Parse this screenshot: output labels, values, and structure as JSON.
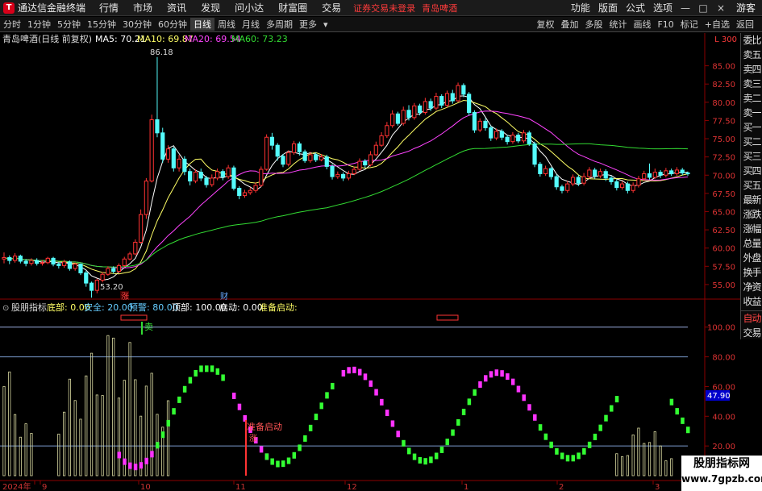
{
  "window": {
    "app_title": "通达信金融终端",
    "notice": "证券交易未登录",
    "stock_title": "青岛啤酒",
    "guest": "游客"
  },
  "menu": {
    "left": [
      "行情",
      "市场",
      "资讯",
      "发现",
      "问小达",
      "财富圈",
      "交易"
    ],
    "right": [
      "功能",
      "版面",
      "公式",
      "选项"
    ]
  },
  "window_controls": [
    "—",
    "□",
    "×"
  ],
  "toolbar": {
    "periods": [
      "分时",
      "1分钟",
      "5分钟",
      "15分钟",
      "30分钟",
      "60分钟",
      "日线",
      "周线",
      "月线",
      "多周期",
      "更多"
    ],
    "active_period": "日线",
    "tools": [
      "复权",
      "叠加",
      "多股",
      "统计",
      "画线",
      "F10",
      "标记",
      "+自选",
      "返回"
    ]
  },
  "main_chart": {
    "stock_label": "青岛啤酒(日线 前复权)",
    "ma_legend": [
      {
        "label": "MA5: 70.21",
        "color": "#ffffff"
      },
      {
        "label": "MA10: 69.87",
        "color": "#ffff66"
      },
      {
        "label": "MA20: 69.54",
        "color": "#ff44ff"
      },
      {
        "label": "MA60: 73.23",
        "color": "#33dd33"
      }
    ],
    "y_axis": {
      "ticks": [
        55.0,
        57.5,
        60.0,
        62.5,
        65.0,
        67.5,
        70.0,
        72.5,
        75.0,
        77.5,
        80.0,
        82.5,
        85.0
      ],
      "range": [
        53.0,
        87.5
      ]
    },
    "annotations": {
      "high": "86.18",
      "low": "53.20",
      "mark_zhang": "涨",
      "mark_cai": "财",
      "corner": "L 300"
    },
    "candles": [
      [
        58.5,
        58.7,
        59.4,
        57.9
      ],
      [
        58.7,
        58.3,
        59.0,
        57.8
      ],
      [
        58.3,
        58.9,
        59.3,
        58.0
      ],
      [
        58.9,
        58.2,
        59.1,
        57.9
      ],
      [
        58.2,
        57.9,
        58.5,
        57.5
      ],
      [
        57.9,
        58.3,
        58.6,
        57.6
      ],
      [
        58.3,
        57.9,
        58.6,
        57.6
      ],
      [
        57.9,
        58.0,
        58.3,
        57.6
      ],
      [
        58.0,
        58.6,
        58.8,
        57.8
      ],
      [
        58.6,
        57.8,
        58.8,
        57.5
      ],
      [
        57.8,
        57.6,
        58.1,
        57.2
      ],
      [
        57.6,
        58.1,
        58.4,
        57.3
      ],
      [
        58.1,
        57.2,
        58.3,
        56.9
      ],
      [
        57.2,
        57.8,
        58.0,
        56.9
      ],
      [
        57.8,
        56.6,
        57.9,
        56.3
      ],
      [
        56.6,
        55.2,
        56.9,
        54.7
      ],
      [
        55.2,
        54.2,
        55.4,
        53.2
      ],
      [
        54.2,
        55.6,
        55.8,
        53.8
      ],
      [
        55.6,
        56.4,
        56.7,
        55.3
      ],
      [
        56.4,
        57.2,
        57.5,
        56.2
      ],
      [
        57.2,
        56.8,
        57.5,
        56.5
      ],
      [
        56.8,
        57.6,
        57.9,
        56.6
      ],
      [
        57.6,
        58.5,
        58.8,
        57.4
      ],
      [
        58.5,
        59.2,
        59.5,
        58.3
      ],
      [
        59.2,
        60.8,
        61.2,
        59.0
      ],
      [
        60.8,
        64.6,
        65.3,
        60.6
      ],
      [
        64.6,
        69.2,
        69.6,
        64.0
      ],
      [
        69.2,
        77.6,
        78.3,
        69.0
      ],
      [
        77.6,
        75.8,
        86.2,
        75.2
      ],
      [
        75.8,
        72.2,
        76.5,
        71.7
      ],
      [
        72.2,
        73.6,
        74.1,
        71.7
      ],
      [
        73.6,
        71.0,
        73.9,
        70.5
      ],
      [
        71.0,
        72.2,
        72.8,
        70.5
      ],
      [
        72.2,
        70.5,
        72.6,
        70.0
      ],
      [
        70.5,
        69.2,
        70.9,
        68.6
      ],
      [
        69.2,
        70.4,
        70.8,
        68.9
      ],
      [
        70.4,
        69.6,
        70.9,
        69.2
      ],
      [
        69.6,
        68.7,
        69.9,
        68.3
      ],
      [
        68.7,
        69.6,
        70.1,
        68.4
      ],
      [
        69.6,
        70.5,
        70.9,
        69.3
      ],
      [
        70.5,
        69.8,
        70.8,
        69.3
      ],
      [
        69.8,
        71.0,
        71.4,
        69.5
      ],
      [
        71.0,
        68.2,
        71.3,
        67.9
      ],
      [
        68.2,
        67.2,
        68.5,
        66.7
      ],
      [
        67.2,
        67.6,
        68.0,
        66.9
      ],
      [
        67.6,
        67.9,
        68.3,
        67.3
      ],
      [
        67.9,
        68.6,
        69.0,
        67.6
      ],
      [
        68.6,
        70.8,
        71.2,
        68.4
      ],
      [
        70.8,
        75.2,
        75.6,
        70.6
      ],
      [
        75.2,
        74.1,
        75.8,
        73.5
      ],
      [
        74.1,
        72.6,
        74.4,
        72.0
      ],
      [
        72.6,
        71.5,
        72.9,
        71.1
      ],
      [
        71.5,
        73.1,
        73.4,
        71.2
      ],
      [
        73.1,
        74.3,
        74.7,
        72.8
      ],
      [
        74.3,
        73.2,
        74.6,
        72.7
      ],
      [
        73.2,
        72.0,
        73.5,
        71.7
      ],
      [
        72.0,
        72.8,
        73.2,
        71.7
      ],
      [
        72.8,
        72.1,
        73.1,
        71.8
      ],
      [
        72.1,
        72.5,
        72.9,
        71.9
      ],
      [
        72.5,
        71.2,
        72.8,
        70.8
      ],
      [
        71.2,
        69.8,
        71.5,
        69.4
      ],
      [
        69.8,
        70.1,
        70.5,
        69.5
      ],
      [
        70.1,
        69.6,
        70.4,
        69.2
      ],
      [
        69.6,
        70.2,
        70.6,
        69.3
      ],
      [
        70.2,
        70.8,
        71.2,
        70.0
      ],
      [
        70.8,
        71.9,
        72.3,
        70.6
      ],
      [
        71.9,
        71.4,
        72.2,
        71.0
      ],
      [
        71.4,
        72.8,
        73.3,
        71.2
      ],
      [
        72.8,
        74.1,
        74.6,
        72.6
      ],
      [
        74.1,
        75.4,
        75.9,
        73.9
      ],
      [
        75.4,
        76.8,
        77.3,
        75.1
      ],
      [
        76.8,
        78.4,
        78.9,
        76.5
      ],
      [
        78.4,
        77.1,
        78.7,
        76.8
      ],
      [
        77.1,
        78.9,
        79.4,
        76.8
      ],
      [
        78.9,
        77.9,
        79.6,
        77.5
      ],
      [
        77.9,
        79.5,
        79.9,
        77.6
      ],
      [
        79.5,
        78.6,
        79.8,
        78.2
      ],
      [
        78.6,
        80.1,
        80.6,
        78.3
      ],
      [
        80.1,
        79.2,
        80.5,
        78.8
      ],
      [
        79.2,
        80.8,
        81.3,
        78.9
      ],
      [
        80.8,
        79.6,
        81.1,
        79.2
      ],
      [
        79.6,
        81.2,
        81.6,
        79.3
      ],
      [
        81.2,
        80.2,
        81.7,
        79.8
      ],
      [
        80.2,
        82.3,
        82.7,
        80.0
      ],
      [
        82.3,
        81.1,
        82.6,
        80.7
      ],
      [
        81.1,
        78.6,
        81.4,
        78.2
      ],
      [
        78.6,
        76.2,
        78.9,
        75.8
      ],
      [
        76.2,
        77.4,
        77.8,
        75.9
      ],
      [
        77.4,
        76.5,
        77.8,
        76.1
      ],
      [
        76.5,
        75.1,
        76.8,
        74.7
      ],
      [
        75.1,
        76.0,
        76.4,
        74.8
      ],
      [
        76.0,
        75.2,
        76.3,
        74.8
      ],
      [
        75.2,
        74.6,
        75.5,
        74.2
      ],
      [
        74.6,
        75.5,
        75.9,
        74.3
      ],
      [
        75.5,
        74.7,
        75.8,
        74.4
      ],
      [
        74.7,
        75.8,
        76.2,
        74.4
      ],
      [
        75.8,
        74.3,
        76.1,
        74.0
      ],
      [
        74.3,
        71.5,
        74.6,
        71.1
      ],
      [
        71.5,
        70.2,
        71.8,
        69.8
      ],
      [
        70.2,
        70.9,
        71.3,
        69.9
      ],
      [
        70.9,
        69.8,
        71.1,
        69.4
      ],
      [
        69.8,
        68.4,
        70.1,
        68.0
      ],
      [
        68.4,
        67.9,
        68.7,
        67.5
      ],
      [
        67.9,
        68.8,
        69.2,
        67.6
      ],
      [
        68.8,
        69.7,
        70.1,
        68.5
      ],
      [
        69.7,
        68.9,
        70.0,
        68.5
      ],
      [
        68.9,
        69.8,
        70.3,
        68.6
      ],
      [
        69.8,
        70.7,
        71.1,
        69.5
      ],
      [
        70.7,
        69.9,
        71.0,
        69.5
      ],
      [
        69.9,
        70.5,
        70.9,
        69.6
      ],
      [
        70.5,
        69.6,
        70.8,
        69.2
      ],
      [
        69.6,
        69.1,
        69.9,
        68.7
      ],
      [
        69.1,
        68.3,
        69.4,
        67.9
      ],
      [
        68.3,
        68.8,
        69.2,
        68.0
      ],
      [
        68.8,
        67.9,
        69.1,
        67.5
      ],
      [
        67.9,
        68.6,
        69.0,
        67.6
      ],
      [
        68.6,
        69.5,
        69.9,
        68.3
      ],
      [
        69.5,
        70.2,
        70.6,
        69.2
      ],
      [
        70.2,
        69.7,
        71.6,
        69.4
      ],
      [
        69.7,
        70.4,
        70.9,
        69.5
      ],
      [
        70.4,
        70.0,
        70.7,
        69.6
      ],
      [
        70.0,
        70.6,
        71.0,
        69.7
      ],
      [
        70.6,
        70.2,
        70.9,
        69.9
      ],
      [
        70.2,
        70.7,
        71.1,
        69.9
      ],
      [
        70.7,
        70.3,
        71.0,
        70.0
      ],
      [
        70.3,
        70.2,
        70.5,
        69.9
      ]
    ]
  },
  "sub_chart": {
    "legend": [
      {
        "label": "股朋指标",
        "color": "#dddddd"
      },
      {
        "label": "底部: 0.00",
        "color": "#ffff66"
      },
      {
        "label": "安全: 20.00",
        "color": "#66ccff"
      },
      {
        "label": "预警: 80.00",
        "color": "#66ccff"
      },
      {
        "label": "顶部: 100.00",
        "color": "#ffffff"
      },
      {
        "label": "启动: 0.00",
        "color": "#ffffff"
      },
      {
        "label": "准备启动:",
        "color": "#ffff66"
      }
    ],
    "y_axis": {
      "ticks": [
        "20.00",
        "40.00",
        "60.00",
        "80.00",
        "100.00"
      ],
      "range": [
        0,
        108
      ]
    },
    "current_value": "47.90",
    "text_marks": {
      "sell": "卖",
      "prepare": "准备启动",
      "up": "涨"
    },
    "x_labels": [
      "2024年",
      "9",
      "10",
      "11",
      "12",
      "1",
      "2",
      "3"
    ],
    "magenta_segments": [
      [
        21,
        28
      ],
      [
        42,
        48
      ],
      [
        62,
        72
      ],
      [
        87,
        97
      ],
      [
        141,
        150
      ],
      [
        150,
        157
      ],
      [
        159,
        166
      ]
    ],
    "green_segments": [
      [
        28,
        40
      ],
      [
        48,
        60
      ],
      [
        73,
        86
      ],
      [
        98,
        112
      ],
      [
        122,
        140
      ],
      [
        151,
        154
      ],
      [
        157,
        159
      ]
    ]
  },
  "side_panel": {
    "items": [
      "委比",
      "卖五",
      "卖四",
      "卖三",
      "卖二",
      "卖一",
      "买一",
      "买二",
      "买三",
      "买四",
      "买五",
      "最新",
      "涨跌",
      "涨幅",
      "总量",
      "外盘",
      "换手",
      "净资",
      "收益"
    ],
    "bottom": [
      "自动",
      "交易"
    ]
  },
  "brand": {
    "name": "股朋指标网",
    "url": "www.7gpzb.com"
  }
}
